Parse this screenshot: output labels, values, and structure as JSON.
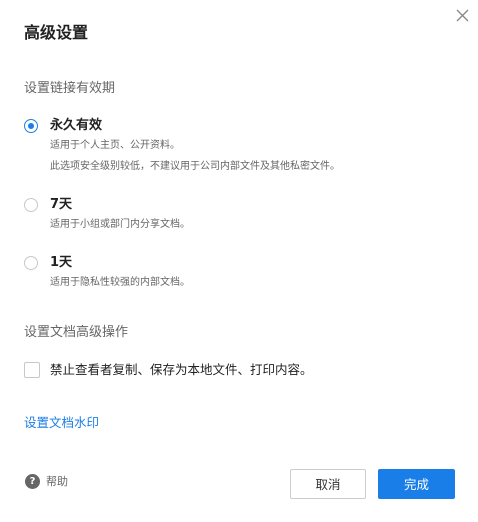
{
  "dialog": {
    "title": "高级设置",
    "close_icon": "close-icon"
  },
  "link_validity": {
    "section_label": "设置链接有效期",
    "selected": "forever",
    "options": [
      {
        "id": "forever",
        "label": "永久有效",
        "descriptions": [
          "适用于个人主页、公开资料。",
          "此选项安全级别较低，不建议用于公司内部文件及其他私密文件。"
        ]
      },
      {
        "id": "7days",
        "label": "7天",
        "descriptions": [
          "适用于小组或部门内分享文档。"
        ]
      },
      {
        "id": "1day",
        "label": "1天",
        "descriptions": [
          "适用于隐私性较强的内部文档。"
        ]
      }
    ]
  },
  "advanced_ops": {
    "section_label": "设置文档高级操作",
    "checkbox_label": "禁止查看者复制、保存为本地文件、打印内容。",
    "checked": false
  },
  "watermark": {
    "link_label": "设置文档水印"
  },
  "footer": {
    "help_icon": "question-icon",
    "help_glyph": "?",
    "help_label": "帮助",
    "cancel_label": "取消",
    "done_label": "完成"
  },
  "colors": {
    "accent": "#1a7ee8",
    "text_primary": "#222222",
    "text_secondary": "#666666",
    "border": "#cccccc"
  }
}
